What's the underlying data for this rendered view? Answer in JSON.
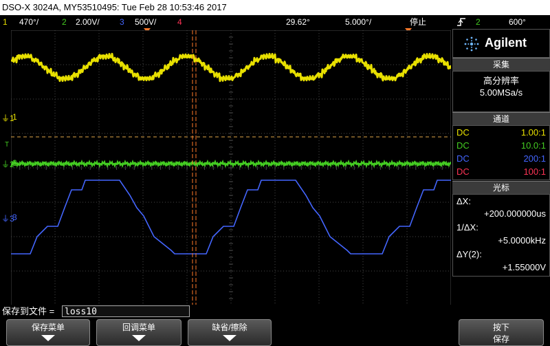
{
  "titlebar": {
    "text": "DSO-X 3024A, MY53510495: Tue Feb 28 10:53:46 2017"
  },
  "status": {
    "ch1_num": "1",
    "ch1_scale": "470°/",
    "ch2_num": "2",
    "ch2_scale": "2.00V/",
    "ch3_num": "3",
    "ch3_scale": "500V/",
    "ch4_num": "4",
    "time_delay": "29.62°",
    "time_scale": "5.000°/",
    "run_state": "停止",
    "trig_slope_icon": "rising-edge-icon",
    "trig_src": "2",
    "trig_level": "600°"
  },
  "colors": {
    "ch1": "#e8e000",
    "ch2": "#44cc22",
    "ch3": "#4466ff",
    "ch4": "#ff3355",
    "cursor": "#ff7a2a",
    "ref": "#e4a94a",
    "grid": "#4a4a4a"
  },
  "markers": {
    "ch1": "1",
    "ch2": "2",
    "ch3": "3",
    "trig": "T"
  },
  "brand": {
    "name": "Agilent",
    "logo_icon": "agilent-spark-icon"
  },
  "acquire": {
    "header": "采集",
    "mode": "高分辨率",
    "rate": "5.00MSa/s"
  },
  "channels": {
    "header": "通道",
    "rows": [
      {
        "coupling": "DC",
        "probe": "1.00:1"
      },
      {
        "coupling": "DC",
        "probe": "10.0:1"
      },
      {
        "coupling": "DC",
        "probe": "200:1"
      },
      {
        "coupling": "DC",
        "probe": "100:1"
      }
    ]
  },
  "cursors": {
    "header": "光标",
    "dx_label": "ΔX:",
    "dx_value": "+200.000000us",
    "inv_label": "1/ΔX:",
    "inv_value": "+5.0000kHz",
    "dy_label": "ΔY(2):",
    "dy_value": "+1.55000V"
  },
  "save": {
    "label": "保存到文件 =",
    "filename": "loss10"
  },
  "softkeys": {
    "k1": "保存菜单",
    "k2": "回调菜单",
    "k3": "缺省/擦除",
    "k4_line1": "按下",
    "k4_line2": "保存"
  }
}
